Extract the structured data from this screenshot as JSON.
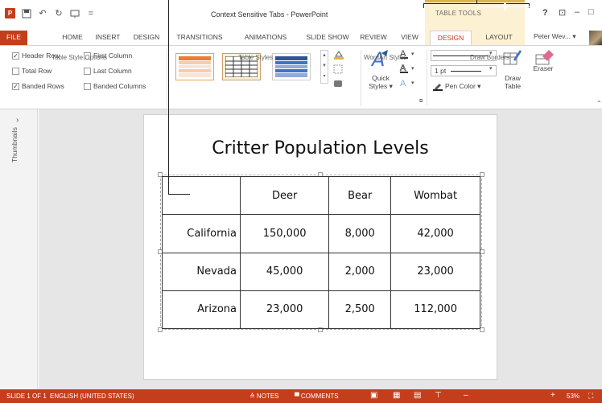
{
  "window": {
    "title": "Context Sensitive Tabs - PowerPoint",
    "app_icon": "P"
  },
  "qat": {
    "save_icon": "save-icon",
    "undo_icon": "undo-icon",
    "redo_icon": "redo-icon",
    "start_icon": "start-from-beginning-icon"
  },
  "table_tools": {
    "label": "TABLE TOOLS",
    "accent": "#e0b34a",
    "bg": "#fdf1d3"
  },
  "help": "?",
  "window_controls": {
    "restore": "⊡",
    "minimize": "–",
    "maximize": "□",
    "close": "✕"
  },
  "tabs": [
    "FILE",
    "HOME",
    "INSERT",
    "DESIGN",
    "TRANSITIONS",
    "ANIMATIONS",
    "SLIDE SHOW",
    "REVIEW",
    "VIEW",
    "DESIGN",
    "LAYOUT"
  ],
  "user": "Peter Wev... ▾",
  "ribbon": {
    "table_style_options": {
      "label": "Table Style Options",
      "options": [
        {
          "label": "Header Row",
          "checked": true
        },
        {
          "label": "First Column",
          "checked": false
        },
        {
          "label": "Total Row",
          "checked": false
        },
        {
          "label": "Last Column",
          "checked": false
        },
        {
          "label": "Banded Rows",
          "checked": true
        },
        {
          "label": "Banded Columns",
          "checked": false
        }
      ]
    },
    "table_styles": {
      "label": "Table Styles"
    },
    "wordart": {
      "label": "WordArt Styles",
      "quick_styles": "Quick Styles ▾",
      "quick_line1": "Quick",
      "quick_line2": "Styles ▾"
    },
    "draw_borders": {
      "label": "Draw Borders",
      "pen_weight": "1 pt",
      "pen_color": "Pen Color ▾",
      "draw_table": "Draw Table",
      "draw_line1": "Draw",
      "draw_line2": "Table",
      "eraser": "Eraser"
    }
  },
  "thumbnails": {
    "label": "Thumbnails",
    "arrow": "›"
  },
  "slide": {
    "title": "Critter Population Levels",
    "header": [
      "",
      "Deer",
      "Bear",
      "Wombat"
    ],
    "rows": [
      {
        "state": "California",
        "deer": "150,000",
        "bear": "8,000",
        "wombat": "42,000"
      },
      {
        "state": "Nevada",
        "deer": "45,000",
        "bear": "2,000",
        "wombat": "23,000"
      },
      {
        "state": "Arizona",
        "deer": "23,000",
        "bear": "2,500",
        "wombat": "112,000"
      }
    ]
  },
  "status": {
    "slide": "SLIDE 1 OF 1",
    "language": "ENGLISH (UNITED STATES)",
    "notes": "≙ NOTES",
    "comments": "▀ COMMENTS",
    "zoom": "53%",
    "bg": "#c43e1c"
  }
}
